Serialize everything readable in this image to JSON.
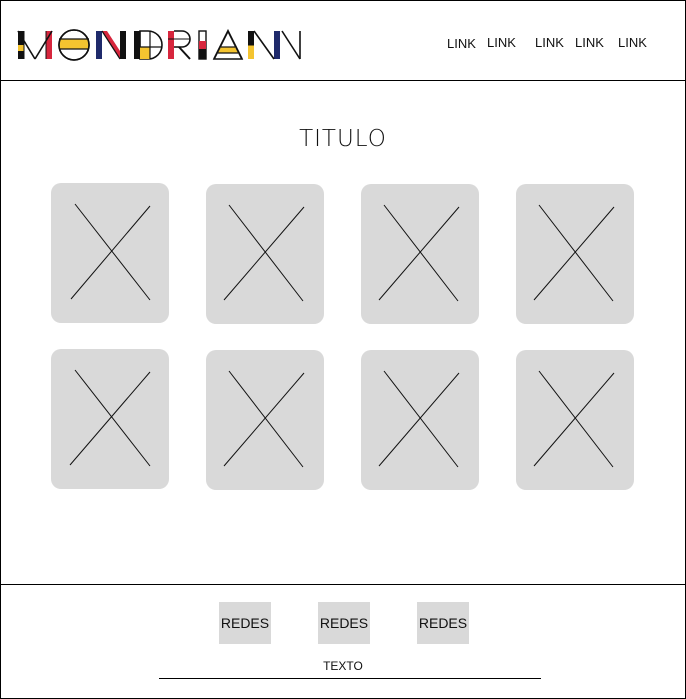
{
  "header": {
    "logo_text": "MONDRIAN",
    "nav": [
      "LINK",
      "LINK",
      "LINK",
      "LINK",
      "LINK"
    ]
  },
  "main": {
    "title": "TITULO",
    "cards_placeholder_icon": "x-placeholder-icon",
    "card_count": 8
  },
  "footer": {
    "social_buttons": [
      "REDES",
      "REDES",
      "REDES"
    ],
    "text": "TEXTO"
  },
  "colors": {
    "placeholder_gray": "#d9d9d9",
    "mondrian_yellow": "#f4c430",
    "mondrian_red": "#d7263d",
    "mondrian_blue": "#1f2a6b",
    "black": "#111111"
  }
}
